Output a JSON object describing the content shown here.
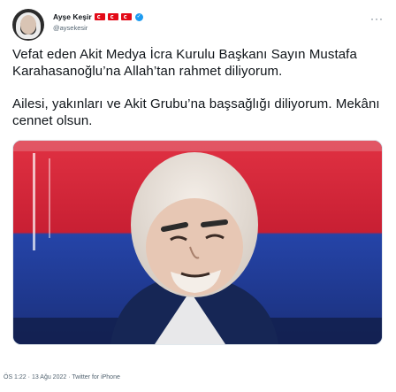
{
  "tweet": {
    "author": {
      "display_name": "Ayşe Keşir",
      "handle": "@aysekesir",
      "flags": [
        "turkey-flag",
        "turkey-flag",
        "turkey-flag"
      ],
      "verified": true
    },
    "text_paragraphs": [
      "Vefat eden Akit Medya İcra Kurulu Başkanı Sayın Mustafa Karahasanoğlu’na Allah’tan rahmet diliyorum.",
      "Ailesi, yakınları ve Akit Grubu’na başsağlığı diliyorum. Mekânı cennet olsun."
    ],
    "footer": {
      "time": "ÖS 1:22",
      "separator": "·",
      "date": "13 Ağu 2022",
      "source": "Twitter for iPhone"
    }
  },
  "icons": {
    "more": "more-icon",
    "verified": "verified-badge-icon"
  },
  "colors": {
    "text": "#0f1419",
    "secondary": "#536471",
    "verified": "#1d9bf0",
    "flag_red": "#e30a17",
    "media_red": "#d7263d",
    "media_blue": "#1e3a8a"
  }
}
